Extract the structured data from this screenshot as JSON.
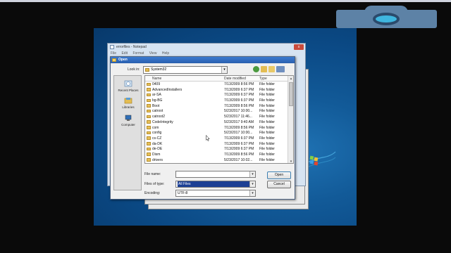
{
  "overlay": {
    "camera_icon": "camera-icon"
  },
  "notepad": {
    "title": "errorfiles - Notepad",
    "close_label": "x",
    "menu": [
      "File",
      "Edit",
      "Format",
      "View",
      "Help"
    ]
  },
  "dialog": {
    "title": "Open",
    "look_in_label": "Look in:",
    "look_in_value": "System32",
    "places": [
      {
        "label": "Recent Places",
        "icon": "recent-places-icon"
      },
      {
        "label": "Libraries",
        "icon": "libraries-icon"
      },
      {
        "label": "Computer",
        "icon": "computer-icon"
      }
    ],
    "columns": {
      "name": "Name",
      "date_modified": "Date modified",
      "type": "Type"
    },
    "files": [
      {
        "name": "0409",
        "date": "7/13/2009 8:56 PM",
        "type": "File folder"
      },
      {
        "name": "AdvancedInstallers",
        "date": "7/13/2009 6:37 PM",
        "type": "File folder"
      },
      {
        "name": "ar-SA",
        "date": "7/13/2009 6:37 PM",
        "type": "File folder"
      },
      {
        "name": "bg-BG",
        "date": "7/13/2009 6:37 PM",
        "type": "File folder"
      },
      {
        "name": "Boot",
        "date": "7/13/2009 8:56 PM",
        "type": "File folder"
      },
      {
        "name": "catroot",
        "date": "5/23/2017 10:00...",
        "type": "File folder"
      },
      {
        "name": "catroot2",
        "date": "5/23/2017 11:46...",
        "type": "File folder"
      },
      {
        "name": "CodeIntegrity",
        "date": "5/23/2017 9:40 AM",
        "type": "File folder"
      },
      {
        "name": "com",
        "date": "7/13/2009 8:56 PM",
        "type": "File folder"
      },
      {
        "name": "config",
        "date": "5/23/2017 10:00...",
        "type": "File folder"
      },
      {
        "name": "cs-CZ",
        "date": "7/13/2009 6:37 PM",
        "type": "File folder"
      },
      {
        "name": "da-DK",
        "date": "7/13/2009 6:37 PM",
        "type": "File folder"
      },
      {
        "name": "de-DE",
        "date": "7/13/2009 6:37 PM",
        "type": "File folder"
      },
      {
        "name": "Dism",
        "date": "7/13/2009 8:56 PM",
        "type": "File folder"
      },
      {
        "name": "drivers",
        "date": "5/23/2017 10:02...",
        "type": "File folder"
      }
    ],
    "file_name_label": "File name:",
    "file_name_value": "",
    "files_of_type_label": "Files of type:",
    "files_of_type_value": "All Files",
    "encoding_label": "Encoding:",
    "encoding_value": "UTF-8",
    "open_button": "Open",
    "cancel_button": "Cancel",
    "dropdown_glyph": "▾",
    "scroll_up_glyph": "▴",
    "scroll_down_glyph": "▾"
  }
}
